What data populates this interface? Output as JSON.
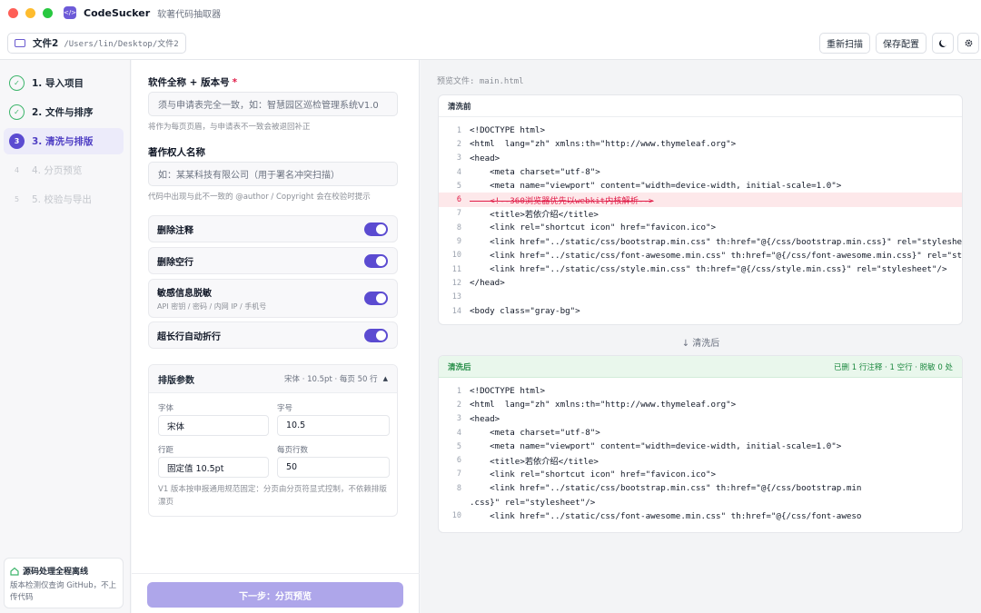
{
  "app": {
    "name": "CodeSucker",
    "subtitle": "软著代码抽取器",
    "logo_glyph": "</>"
  },
  "toolbar": {
    "file_name": "文件2",
    "file_path": "/Users/lin/Desktop/文件2",
    "rescan_label": "重新扫描",
    "save_config_label": "保存配置",
    "theme_icon": "moon-icon",
    "settings_icon": "gear-icon"
  },
  "steps": [
    {
      "num": "✓",
      "label": "1. 导入项目",
      "state": "done"
    },
    {
      "num": "✓",
      "label": "2. 文件与排序",
      "state": "done"
    },
    {
      "num": "3",
      "label": "3. 清洗与排版",
      "state": "current"
    },
    {
      "num": "4",
      "label": "4. 分页预览",
      "state": "todo"
    },
    {
      "num": "5",
      "label": "5. 校验与导出",
      "state": "todo"
    }
  ],
  "sidebar_note": {
    "title": "源码处理全程离线",
    "desc": "版本检测仅查询 GitHub，不上传代码"
  },
  "form": {
    "software_name": {
      "label": "软件全称 + 版本号",
      "required_mark": "*",
      "placeholder": "须与申请表完全一致，如：智慧园区巡检管理系统V1.0",
      "hint": "将作为每页页眉，与申请表不一致会被退回补正"
    },
    "owner": {
      "label": "著作权人名称",
      "placeholder": "如：某某科技有限公司（用于署名冲突扫描）",
      "hint": "代码中出现与此不一致的 @author / Copyright 会在校验时提示"
    },
    "toggles": [
      {
        "title": "删除注释",
        "sub": "",
        "on": true
      },
      {
        "title": "删除空行",
        "sub": "",
        "on": true
      },
      {
        "title": "敏感信息脱敏",
        "sub": "API 密钥 / 密码 / 内网 IP / 手机号",
        "on": true
      },
      {
        "title": "超长行自动折行",
        "sub": "",
        "on": true
      }
    ],
    "layout": {
      "title": "排版参数",
      "summary": "宋体 · 10.5pt · 每页 50 行",
      "font_label": "字体",
      "font_value": "宋体",
      "size_label": "字号",
      "size_value": "10.5",
      "spacing_label": "行距",
      "spacing_value": "固定值 10.5pt",
      "lines_label": "每页行数",
      "lines_value": "50",
      "note": "V1 版本按申报通用规范固定：分页由分页符显式控制，不依赖排版漂页"
    },
    "next_label": "下一步：分页预览"
  },
  "preview": {
    "file_label": "预览文件: main.html",
    "before_title": "清洗前",
    "after_title": "清洗后",
    "after_stats": "已删 1 行注释 · 1 空行 · 脱敏 0 处",
    "arrow_label": "↓ 清洗后",
    "before_lines": [
      {
        "n": "1",
        "code": "<!DOCTYPE html>",
        "removed": false
      },
      {
        "n": "2",
        "code": "<html  lang=\"zh\" xmlns:th=\"http://www.thymeleaf.org\">",
        "removed": false
      },
      {
        "n": "3",
        "code": "<head>",
        "removed": false
      },
      {
        "n": "4",
        "code": "    <meta charset=\"utf-8\">",
        "removed": false
      },
      {
        "n": "5",
        "code": "    <meta name=\"viewport\" content=\"width=device-width, initial-scale=1.0\">",
        "removed": false
      },
      {
        "n": "6",
        "code": "    <!--360浏览器优先以webkit内核解析-->",
        "removed": true
      },
      {
        "n": "7",
        "code": "    <title>若依介绍</title>",
        "removed": false
      },
      {
        "n": "8",
        "code": "    <link rel=\"shortcut icon\" href=\"favicon.ico\">",
        "removed": false
      },
      {
        "n": "9",
        "code": "    <link href=\"../static/css/bootstrap.min.css\" th:href=\"@{/css/bootstrap.min.css}\" rel=\"stylesheet\"/>",
        "removed": false
      },
      {
        "n": "10",
        "code": "    <link href=\"../static/css/font-awesome.min.css\" th:href=\"@{/css/font-awesome.min.css}\" rel=\"styleshe",
        "removed": false
      },
      {
        "n": "11",
        "code": "    <link href=\"../static/css/style.min.css\" th:href=\"@{/css/style.min.css}\" rel=\"stylesheet\"/>",
        "removed": false
      },
      {
        "n": "12",
        "code": "</head>",
        "removed": false
      },
      {
        "n": "13",
        "code": "",
        "removed": false
      },
      {
        "n": "14",
        "code": "<body class=\"gray-bg\">",
        "removed": false
      }
    ],
    "after_lines": [
      {
        "n": "1",
        "code": "<!DOCTYPE html>"
      },
      {
        "n": "2",
        "code": "<html  lang=\"zh\" xmlns:th=\"http://www.thymeleaf.org\">"
      },
      {
        "n": "3",
        "code": "<head>"
      },
      {
        "n": "4",
        "code": "    <meta charset=\"utf-8\">"
      },
      {
        "n": "5",
        "code": "    <meta name=\"viewport\" content=\"width=device-width, initial-scale=1.0\">"
      },
      {
        "n": "6",
        "code": "    <title>若依介绍</title>"
      },
      {
        "n": "7",
        "code": "    <link rel=\"shortcut icon\" href=\"favicon.ico\">"
      },
      {
        "n": "8",
        "code": "    <link href=\"../static/css/bootstrap.min.css\" th:href=\"@{/css/bootstrap.min"
      },
      {
        "n": "",
        "code": ".css}\" rel=\"stylesheet\"/>"
      },
      {
        "n": "10",
        "code": "    <link href=\"../static/css/font-awesome.min.css\" th:href=\"@{/css/font-aweso"
      }
    ]
  }
}
